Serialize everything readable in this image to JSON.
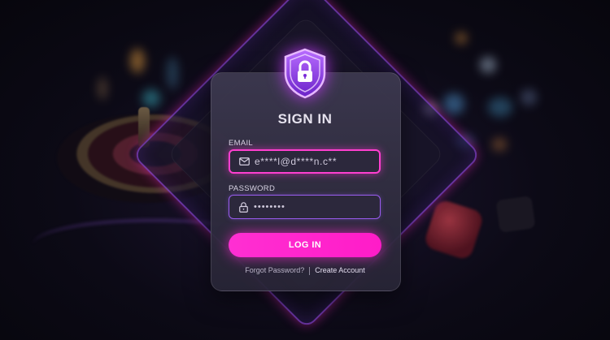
{
  "login": {
    "title": "SIGN IN",
    "email": {
      "label": "EMAIL",
      "value": "e****l@d****n.c**",
      "icon": "mail-icon"
    },
    "password": {
      "label": "PASSWORD",
      "value": "••••••••",
      "icon": "lock-icon"
    },
    "login_button": "LOG IN",
    "forgot_link": "Forgot Password?",
    "create_link": "Create Account",
    "shield_icon": "shield-lock-icon"
  },
  "colors": {
    "accent": "#ff2fd2",
    "secondary_accent": "#9a5cf0",
    "card_bg": "#3a3650",
    "background": "#0c0a16"
  }
}
